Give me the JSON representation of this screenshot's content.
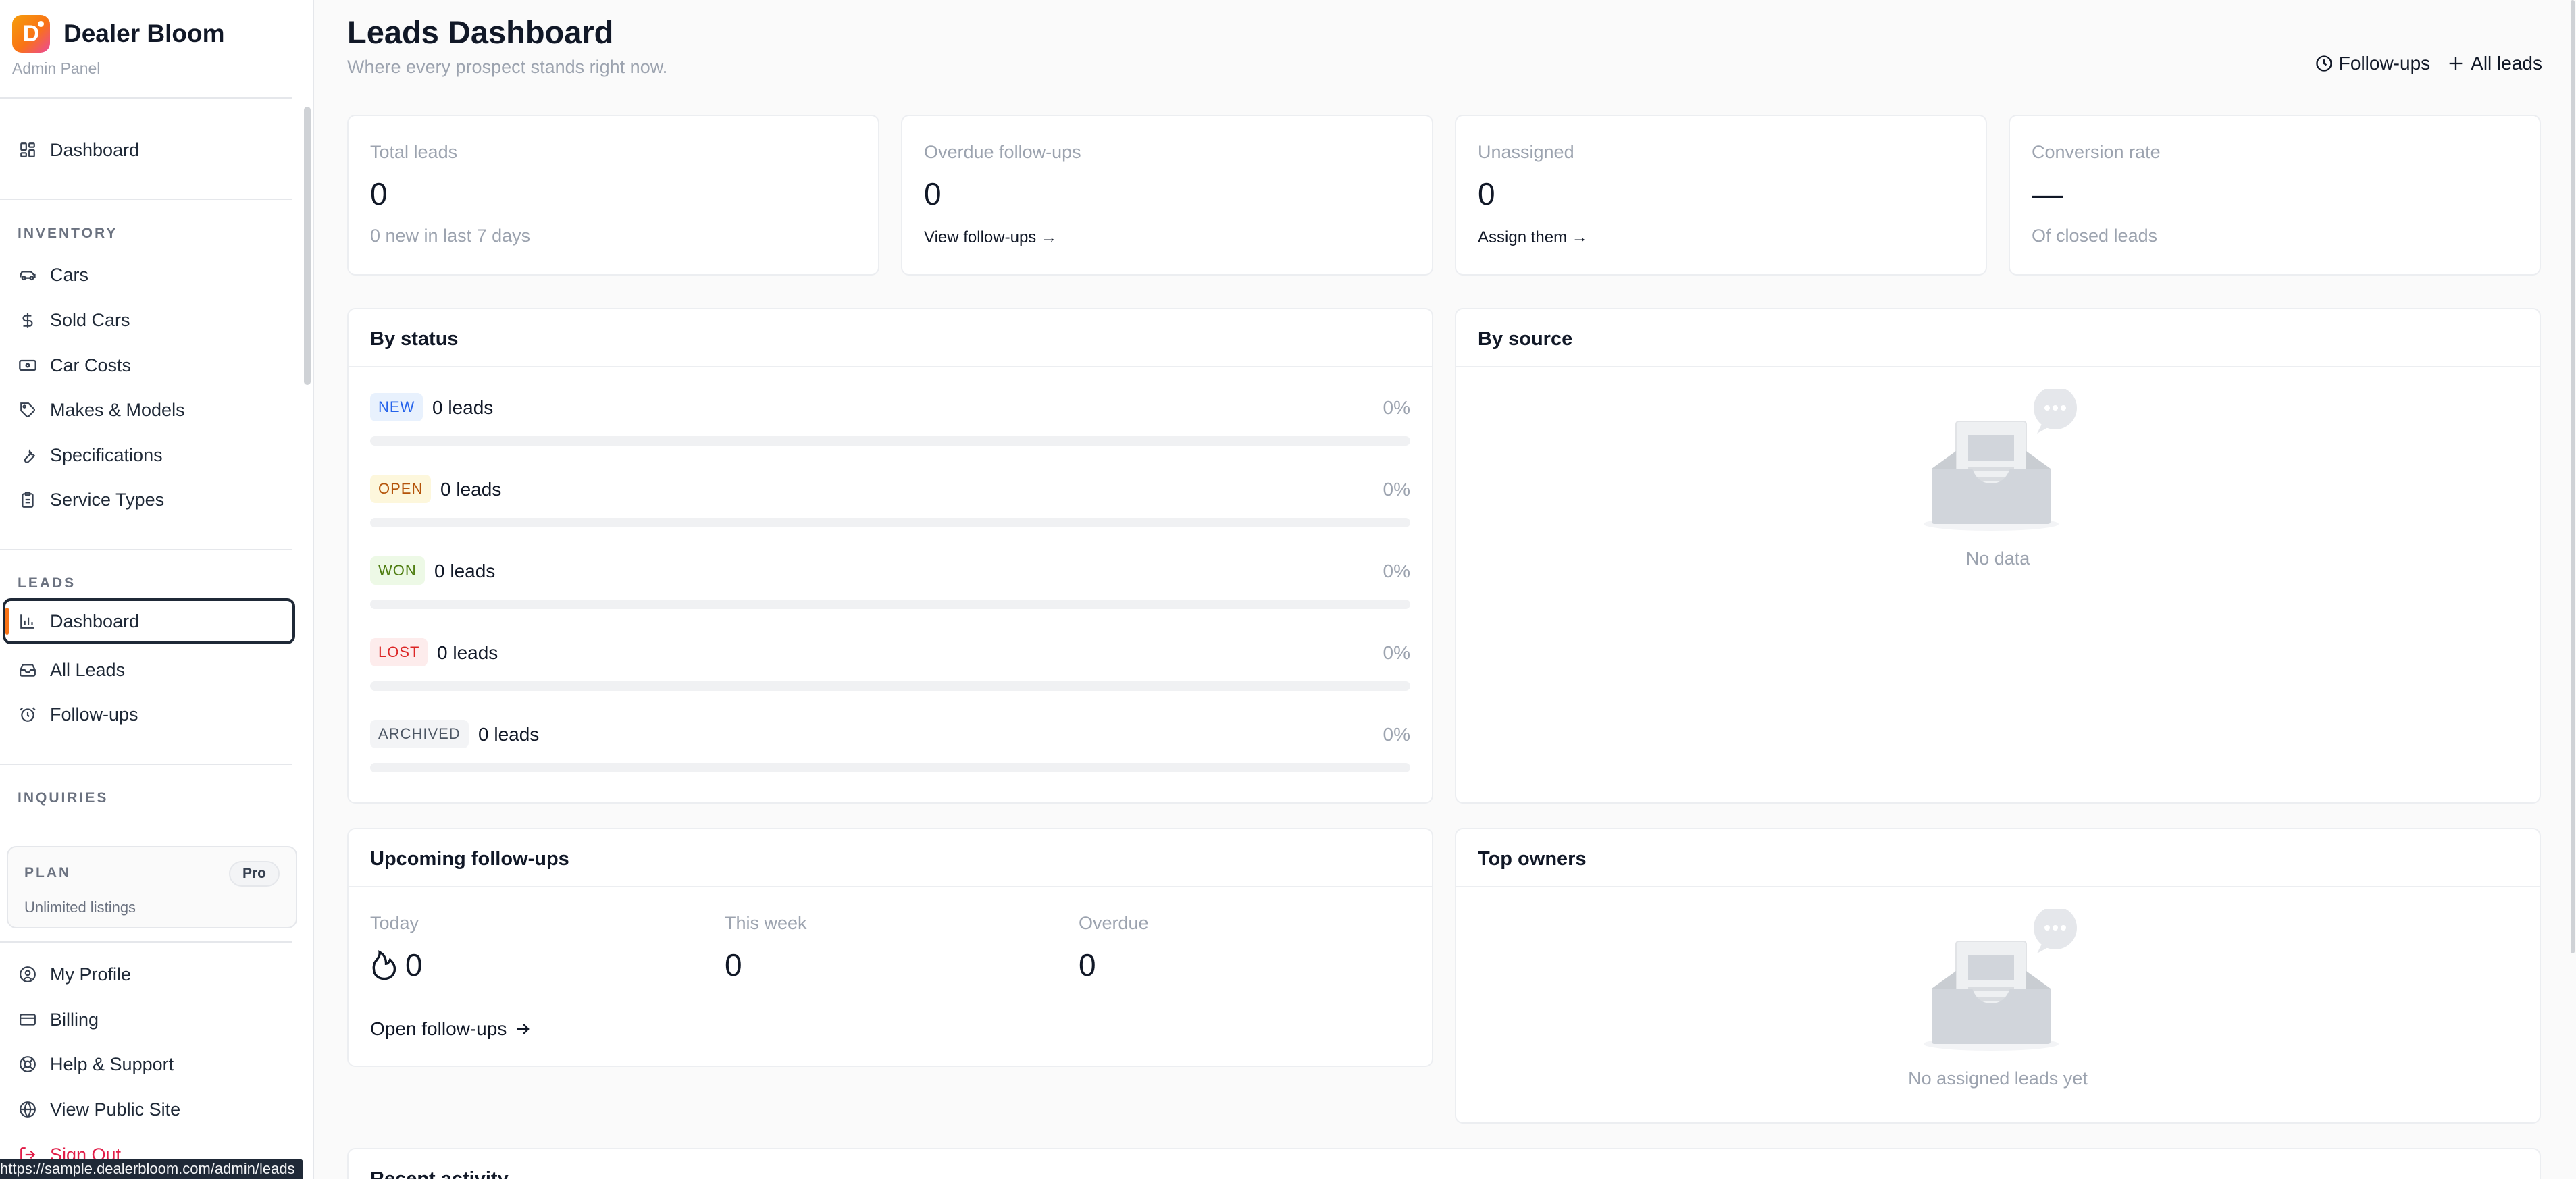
{
  "app": {
    "name": "Dealer Bloom",
    "logo_letter": "D",
    "subtitle": "Admin Panel"
  },
  "sidebar": {
    "top_item": {
      "label": "Dashboard",
      "icon": "grid-icon"
    },
    "inventory": {
      "label": "INVENTORY",
      "items": [
        {
          "label": "Cars",
          "icon": "car-icon"
        },
        {
          "label": "Sold Cars",
          "icon": "dollar-icon"
        },
        {
          "label": "Car Costs",
          "icon": "cash-icon"
        },
        {
          "label": "Makes & Models",
          "icon": "tag-icon"
        },
        {
          "label": "Specifications",
          "icon": "wrench-icon"
        },
        {
          "label": "Service Types",
          "icon": "clipboard-icon"
        }
      ]
    },
    "leads": {
      "label": "LEADS",
      "items": [
        {
          "label": "Dashboard",
          "icon": "bar-chart-icon",
          "active": true
        },
        {
          "label": "All Leads",
          "icon": "inbox-icon"
        },
        {
          "label": "Follow-ups",
          "icon": "alarm-clock-icon"
        }
      ]
    },
    "inquiries": {
      "label": "INQUIRIES"
    },
    "plan": {
      "label": "PLAN",
      "badge": "Pro",
      "description": "Unlimited listings"
    },
    "account_items": [
      {
        "label": "My Profile",
        "icon": "user-circle-icon"
      },
      {
        "label": "Billing",
        "icon": "credit-card-icon"
      },
      {
        "label": "Help & Support",
        "icon": "life-buoy-icon"
      },
      {
        "label": "View Public Site",
        "icon": "globe-icon"
      },
      {
        "label": "Sign Out",
        "icon": "logout-icon"
      }
    ],
    "status_url": "https://sample.dealerbloom.com/admin/leads"
  },
  "header": {
    "title": "Leads Dashboard",
    "subtitle": "Where every prospect stands right now.",
    "actions": [
      {
        "label": "Follow-ups",
        "icon": "clock-icon"
      },
      {
        "label": "All leads",
        "icon": "plus-icon"
      }
    ]
  },
  "kpis": [
    {
      "label": "Total leads",
      "value": "0",
      "footer": "0 new in last 7 days"
    },
    {
      "label": "Overdue follow-ups",
      "value": "0",
      "link": "View follow-ups →"
    },
    {
      "label": "Unassigned",
      "value": "0",
      "link": "Assign them →"
    },
    {
      "label": "Conversion rate",
      "value": "—",
      "footer": "Of closed leads"
    }
  ],
  "by_status": {
    "title": "By status",
    "rows": [
      {
        "status": "NEW",
        "count": "0 leads",
        "percent": "0%",
        "fraction": 0,
        "bg": "#e8f1fd",
        "fg": "#2563eb"
      },
      {
        "status": "OPEN",
        "count": "0 leads",
        "percent": "0%",
        "fraction": 0,
        "bg": "#fdf7dc",
        "fg": "#b45309"
      },
      {
        "status": "WON",
        "count": "0 leads",
        "percent": "0%",
        "fraction": 0,
        "bg": "#edf9e6",
        "fg": "#4d7c0f"
      },
      {
        "status": "LOST",
        "count": "0 leads",
        "percent": "0%",
        "fraction": 0,
        "bg": "#fdecec",
        "fg": "#dc2626"
      },
      {
        "status": "ARCHIVED",
        "count": "0 leads",
        "percent": "0%",
        "fraction": 0,
        "bg": "#f3f4f6",
        "fg": "#4b5563"
      }
    ]
  },
  "by_source": {
    "title": "By source",
    "empty_text": "No data"
  },
  "upcoming": {
    "title": "Upcoming follow-ups",
    "columns": [
      {
        "label": "Today",
        "value": "0",
        "icon": "flame-icon"
      },
      {
        "label": "This week",
        "value": "0"
      },
      {
        "label": "Overdue",
        "value": "0"
      }
    ],
    "link": "Open follow-ups"
  },
  "top_owners": {
    "title": "Top owners",
    "empty_text": "No assigned leads yet"
  },
  "recent_activity": {
    "title": "Recent activity"
  },
  "colors": {
    "accent": "#f97316",
    "danger": "#e11d48"
  }
}
